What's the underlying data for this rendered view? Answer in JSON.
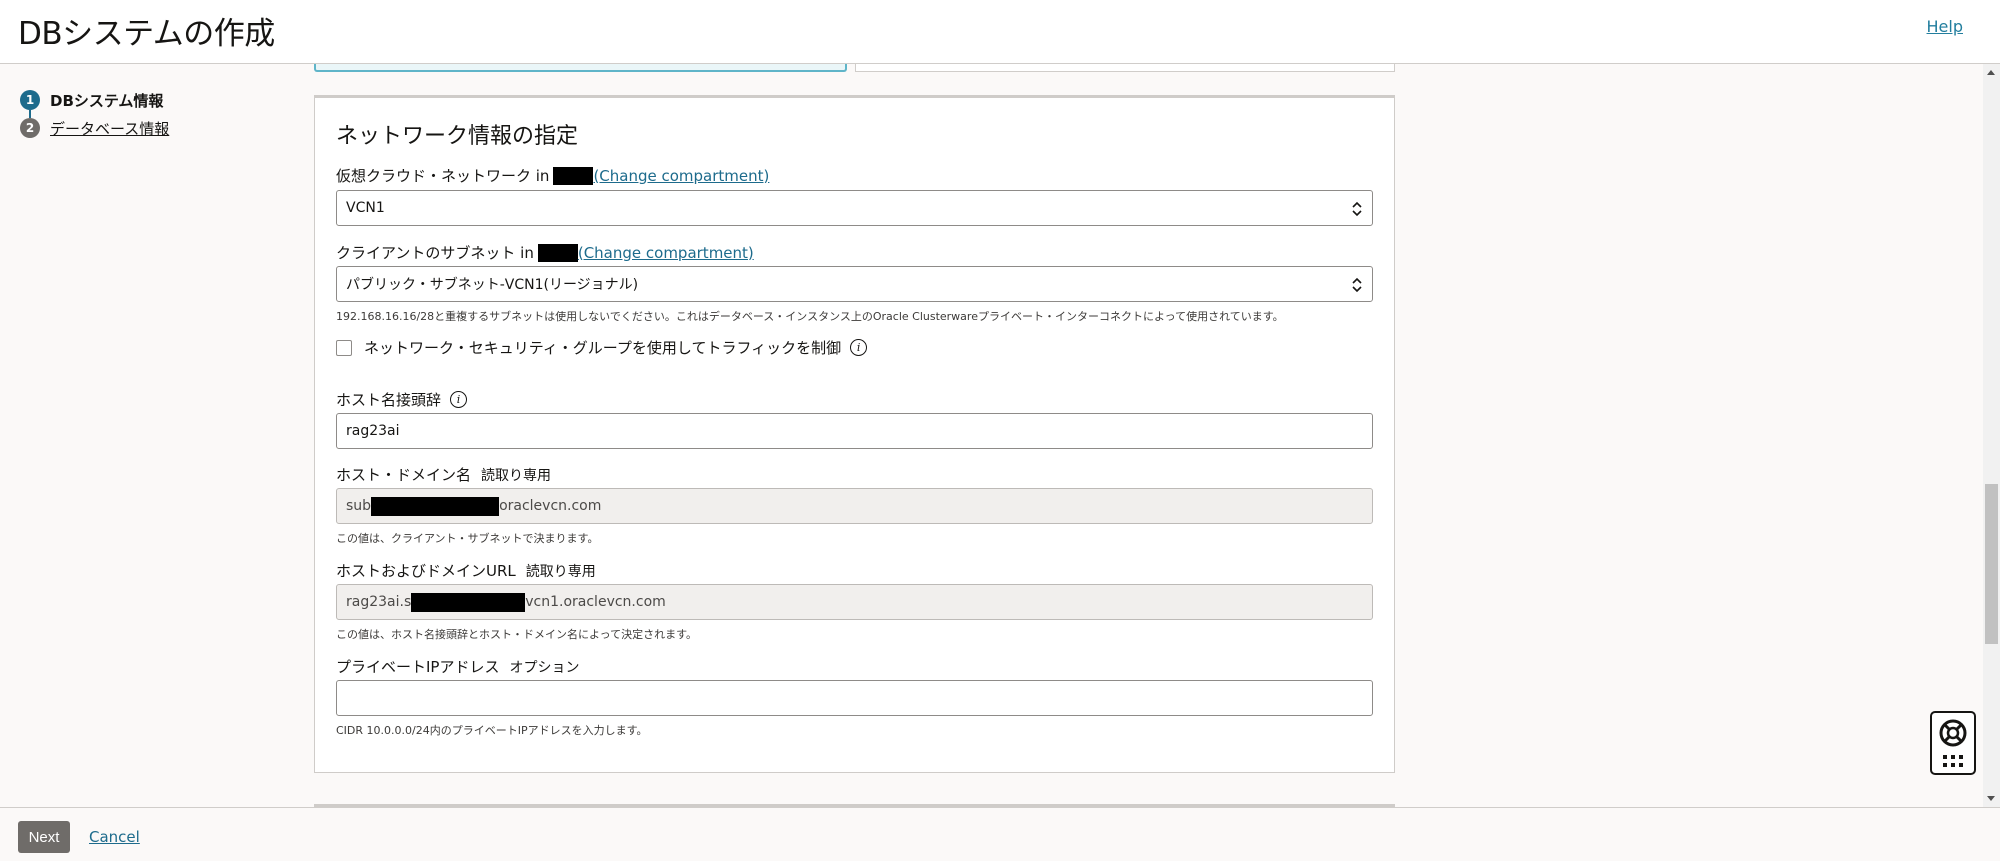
{
  "header": {
    "title": "DBシステムの作成",
    "help_label": "Help"
  },
  "steps": [
    {
      "number": "1",
      "label": "DBシステム情報",
      "state": "active"
    },
    {
      "number": "2",
      "label": "データベース情報",
      "state": "inactive"
    }
  ],
  "network": {
    "title": "ネットワーク情報の指定",
    "vcn": {
      "label": "仮想クラウド・ネットワーク in",
      "change_link": "(Change compartment)",
      "value": "VCN1"
    },
    "subnet": {
      "label": "クライアントのサブネット in",
      "change_link": "(Change compartment)",
      "value": "パブリック・サブネット-VCN1(リージョナル)",
      "hint": "192.168.16.16/28と重複するサブネットは使用しないでください。これはデータベース・インスタンス上のOracle Clusterwareプライベート・インターコネクトによって使用されています。"
    },
    "nsg_checkbox_label": "ネットワーク・セキュリティ・グループを使用してトラフィックを制御",
    "hostname_prefix": {
      "label": "ホスト名接頭辞",
      "value": "rag23ai"
    },
    "host_domain": {
      "label": "ホスト・ドメイン名",
      "readonly_tag": "読取り専用",
      "value_prefix": "sub",
      "value_suffix": "oraclevcn.com",
      "hint": "この値は、クライアント・サブネットで決まります。"
    },
    "host_domain_url": {
      "label": "ホストおよびドメインURL",
      "readonly_tag": "読取り専用",
      "value_prefix": "rag23ai.s",
      "value_suffix": "vcn1.oraclevcn.com",
      "hint": "この値は、ホスト名接頭辞とホスト・ドメイン名によって決定されます。"
    },
    "private_ip": {
      "label": "プライベートIPアドレス",
      "optional_tag": "オプション",
      "value": "",
      "hint": "CIDR 10.0.0.0/24内のプライベートIPアドレスを入力します。"
    }
  },
  "footer": {
    "next_label": "Next",
    "cancel_label": "Cancel"
  },
  "colors": {
    "link": "#1d6b8c",
    "active_step": "#1d6b8c",
    "button": "#6f6c69"
  }
}
